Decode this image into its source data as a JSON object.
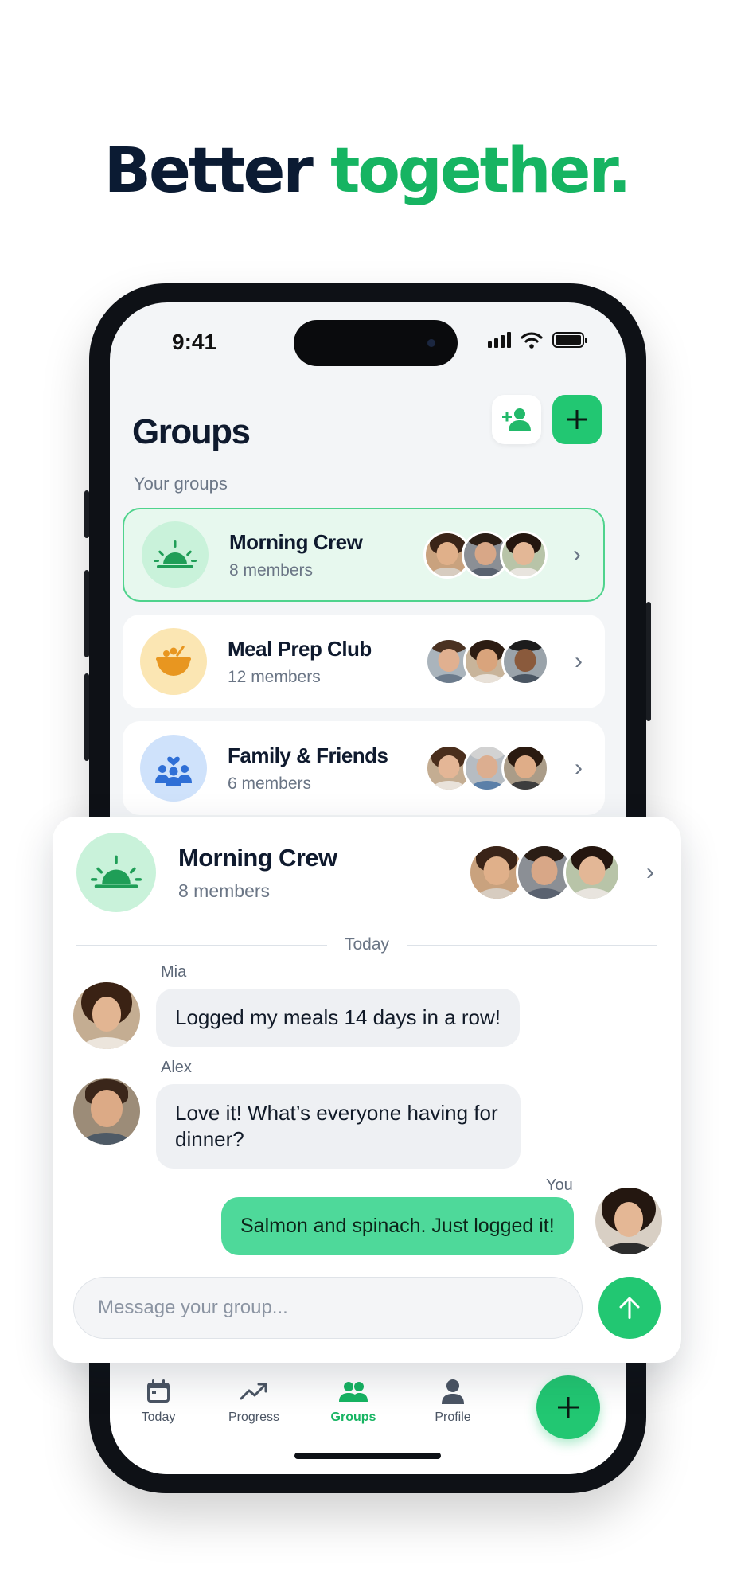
{
  "headline": {
    "part1": "Better",
    "part2": "together."
  },
  "colors": {
    "accent": "#22c772",
    "headline_dark": "#0b1b33",
    "headline_green": "#16b462",
    "active_card_bg": "#e7f8ee",
    "my_bubble": "#4ed99a"
  },
  "status_bar": {
    "time": "9:41",
    "icons": [
      "signal-icon",
      "wifi-icon",
      "battery-icon"
    ]
  },
  "header": {
    "title": "Groups",
    "invite_icon": "add-person-icon",
    "add_icon": "plus-icon"
  },
  "section_label": "Your groups",
  "groups": [
    {
      "name": "Morning Crew",
      "members": "8 members",
      "icon": "sunrise-icon",
      "active": true
    },
    {
      "name": "Meal Prep Club",
      "members": "12 members",
      "icon": "bowl-icon",
      "active": false
    },
    {
      "name": "Family & Friends",
      "members": "6 members",
      "icon": "family-icon",
      "active": false
    }
  ],
  "chat": {
    "title": "Morning Crew",
    "members": "8 members",
    "day_label": "Today",
    "messages": [
      {
        "sender": "Mia",
        "text": "Logged my meals 14 days in a row!",
        "mine": false
      },
      {
        "sender": "Alex",
        "text": "Love it! What’s everyone having for dinner?",
        "mine": false
      },
      {
        "sender": "You",
        "text": "Salmon and spinach. Just logged it!",
        "mine": true
      }
    ],
    "composer_placeholder": "Message your group...",
    "send_icon": "arrow-up-icon"
  },
  "tabs": [
    {
      "label": "Today",
      "icon": "calendar-icon",
      "active": false
    },
    {
      "label": "Progress",
      "icon": "trend-icon",
      "active": false
    },
    {
      "label": "Groups",
      "icon": "people-icon",
      "active": true
    },
    {
      "label": "Profile",
      "icon": "person-icon",
      "active": false
    }
  ],
  "fab_icon": "plus-icon"
}
